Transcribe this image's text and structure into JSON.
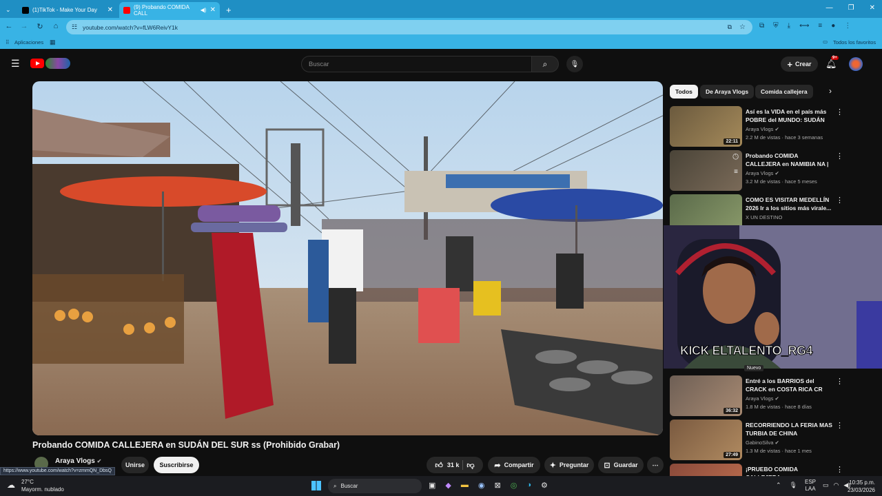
{
  "browser": {
    "tabs": [
      {
        "title": "(1)TikTok - Make Your Day",
        "favicon_color": "#000000"
      },
      {
        "title": "(9) Probando COMIDA CALL",
        "favicon_color": "#ff0000"
      }
    ],
    "url": "youtube.com/watch?v=fLW6ReivY1k",
    "bookmarks": {
      "apps": "Aplicaciones",
      "favorites": "Todos los favoritos"
    }
  },
  "masthead": {
    "search_placeholder": "Buscar",
    "create_label": "Crear",
    "notif_count": "9+"
  },
  "video": {
    "title": "Probando COMIDA CALLEJERA en SUDÁN DEL SUR ss (Prohibido Grabar)",
    "channel": "Araya Vlogs",
    "join_label": "Unirse",
    "subscribe_label": "Suscribirse",
    "likes": "31 k",
    "share_label": "Compartir",
    "ask_label": "Preguntar",
    "save_label": "Guardar"
  },
  "chips": [
    "Todos",
    "De Araya Vlogs",
    "Comida callejera"
  ],
  "recommendations": [
    {
      "title": "Así es la VIDA en el país más POBRE del MUNDO: SUDÁN D...",
      "channel": "Araya Vlogs",
      "meta": "2.2 M de vistas · hace 3 semanas",
      "duration": "22:11",
      "thumb": "#6b5a3e"
    },
    {
      "title": "Probando COMIDA CALLEJERA en NAMIBIA NA | ¡Aquí se com...",
      "channel": "Araya Vlogs",
      "meta": "3.2 M de vistas · hace 5 meses",
      "duration": "",
      "thumb": "#4a4438"
    },
    {
      "title": "COMO ES VISITAR MEDELLÍN 2026  Ir a los sitios más virale...",
      "channel": "X UN DESTINO",
      "meta": "",
      "duration": "",
      "thumb": "#5a6a4a"
    },
    {
      "title": "Entré a los BARRIOS del CRACK en COSTA RICA CR",
      "channel": "Araya Vlogs",
      "meta": "1.8 M de vistas · hace 8 días",
      "duration": "36:32",
      "thumb": "#6e5f55"
    },
    {
      "title": "RECORRIENDO LA FERIA MAS TURBIA DE CHINA",
      "channel": "GabinoSilva",
      "meta": "1.3 M de vistas · hace 1 mes",
      "duration": "27:49",
      "thumb": "#7a5a40"
    },
    {
      "title": "¡PRUEBO COMIDA CALLEJERA",
      "channel": "",
      "meta": "",
      "duration": "",
      "thumb": "#8a4a3a"
    }
  ],
  "webcam": {
    "overlay": "KICK ELTALENTO_RG4",
    "badge": "Nuevo"
  },
  "status_url": "https://www.youtube.com/watch?v=zmmQN_DbsQ",
  "taskbar": {
    "weather_temp": "27°C",
    "weather_desc": "Mayorm. nublado",
    "search_label": "Buscar",
    "lang": "ESP",
    "lang_sub": "LAA",
    "time": "10:35 p.m.",
    "date": "23/03/2026"
  }
}
